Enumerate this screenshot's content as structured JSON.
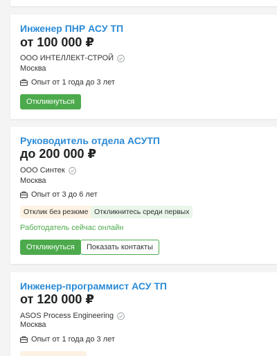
{
  "apply_label": "Откликнуться",
  "vacancies": [
    {
      "title": "Инженер ПНР АСУ ТП",
      "salary": "от 100 000 ₽",
      "company": "ООО ИНТЕЛЛЕКТ-СТРОЙ",
      "city": "Москва",
      "experience": "Опыт от 1 года до 3 лет"
    },
    {
      "title": "Руководитель отдела АСУТП",
      "salary": "до 200 000 ₽",
      "company": "ООО Синтек",
      "city": "Москва",
      "experience": "Опыт от 3 до 6 лет",
      "tags": [
        "Отклик без резюме",
        "Откликнитесь среди первых"
      ],
      "online": "Работодатель сейчас онлайн",
      "contacts_label": "Показать контакты"
    },
    {
      "title": "Инженер-программист АСУ ТП",
      "salary": "от 120 000 ₽",
      "company": "ASOS Process Engineering",
      "city": "Москва",
      "experience": "Опыт от 1 года до 3 лет"
    }
  ],
  "colors": {
    "title": "#2a8ad6",
    "accent_green": "#4caa4c",
    "tag_orange_bg": "#fdf2e3",
    "tag_green_bg": "#e9f6e9"
  }
}
